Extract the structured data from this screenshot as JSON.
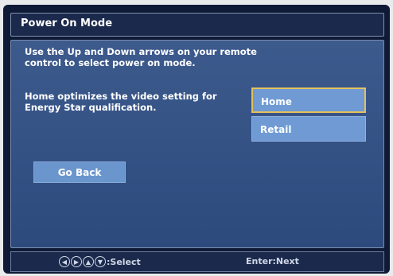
{
  "dialog": {
    "title": "Power On Mode",
    "instruction": "Use the Up and Down arrows on your remote control to select power on mode.",
    "description": "Home optimizes the video setting for Energy Star qualification."
  },
  "options": [
    {
      "label": "Home",
      "selected": true
    },
    {
      "label": "Retail",
      "selected": false
    }
  ],
  "buttons": {
    "go_back": "Go Back"
  },
  "footer": {
    "select_hint": ":Select",
    "next_hint": "Enter:Next",
    "icons": [
      "left-arrow-icon",
      "right-arrow-icon",
      "up-arrow-icon",
      "down-arrow-icon"
    ]
  },
  "colors": {
    "background": "#0f1a36",
    "panel": "#3d5a8d",
    "option": "#6f9ad4",
    "focus_border": "#e5c15a"
  }
}
